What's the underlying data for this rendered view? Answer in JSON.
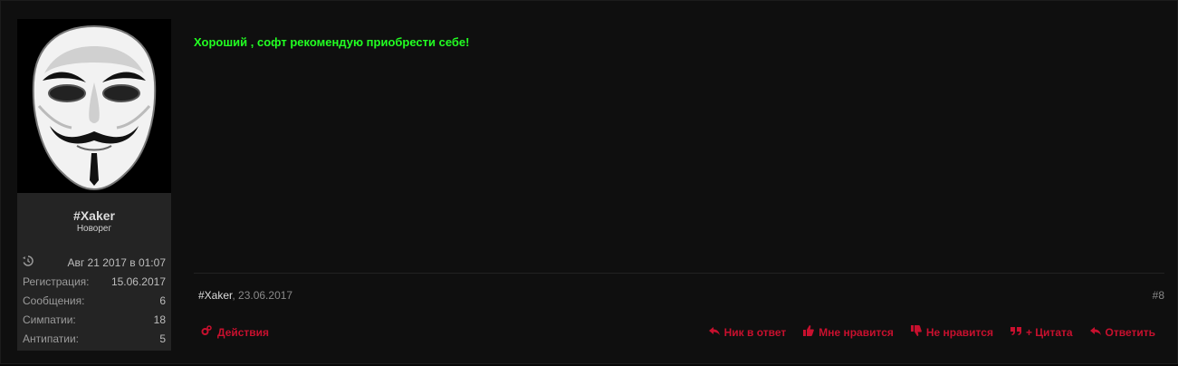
{
  "user": {
    "name": "#Xaker",
    "title": "Новорег",
    "avatar_icon": "guy-fawkes-mask-avatar",
    "stats": [
      {
        "label_icon": "history-icon",
        "label": "",
        "value": "Авг 21 2017 в 01:07"
      },
      {
        "label": "Регистрация:",
        "value": "15.06.2017"
      },
      {
        "label": "Сообщения:",
        "value": "6"
      },
      {
        "label": "Симпатии:",
        "value": "18"
      },
      {
        "label": "Антипатии:",
        "value": "5"
      }
    ]
  },
  "post": {
    "message": "Хороший , софт рекомендую приобрести себе!",
    "author": "#Xaker",
    "date": ", 23.06.2017",
    "number": "#8"
  },
  "actions": {
    "tools_label": "Действия",
    "reply_nick_label": "Ник в ответ",
    "like_label": "Мне нравится",
    "dislike_label": "Не нравится",
    "quote_label": "+ Цитата",
    "reply_label": "Ответить"
  },
  "colors": {
    "accent": "#c8102e",
    "message": "#22ff22",
    "background": "#0f0f0f"
  }
}
